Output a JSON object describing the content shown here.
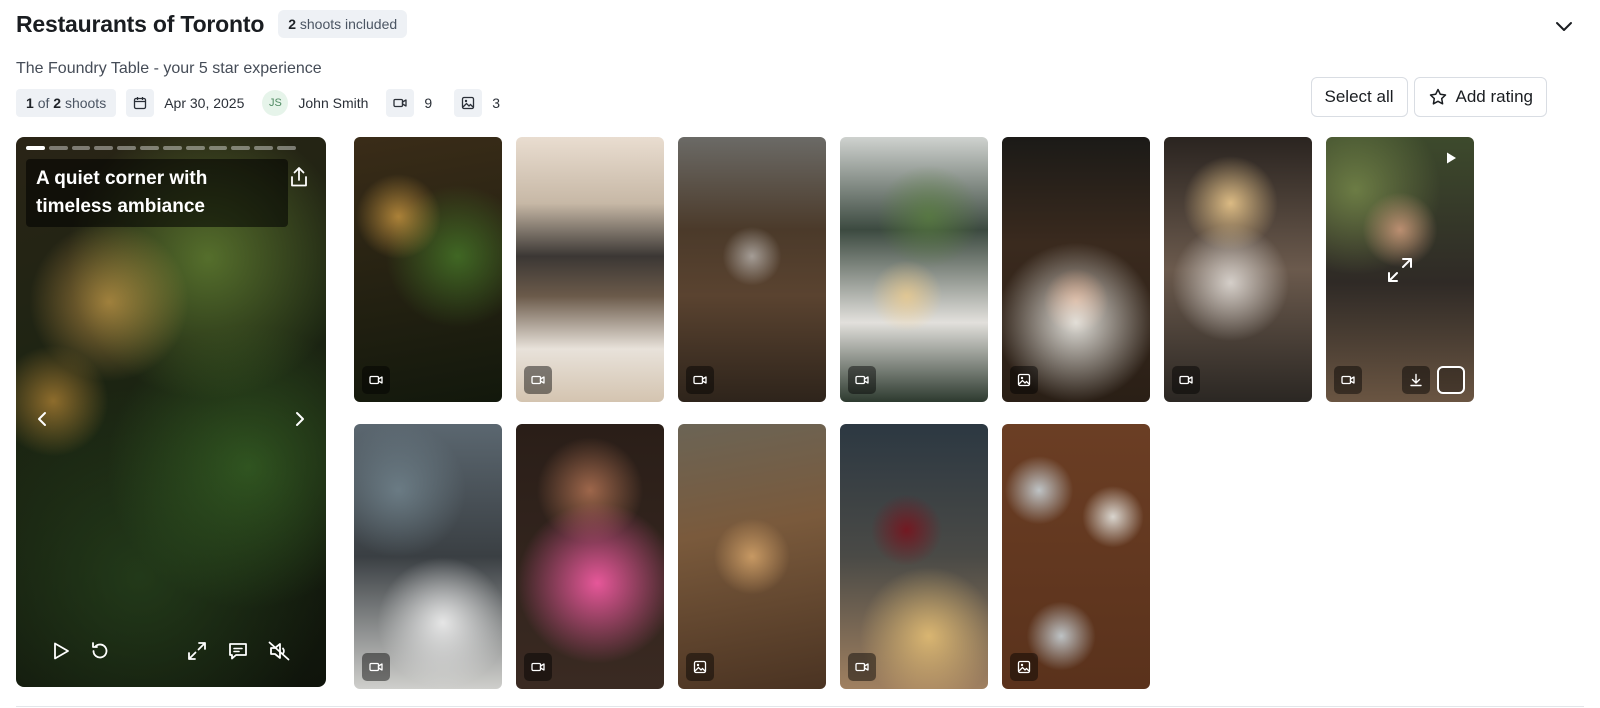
{
  "header": {
    "title": "Restaurants of Toronto",
    "badge_count": "2",
    "badge_text": "shoots included"
  },
  "subtitle": "The Foundry Table - your 5 star experience",
  "meta": {
    "shoot_current": "1",
    "shoot_of": "of",
    "shoot_total": "2",
    "shoot_label": "shoots",
    "date": "Apr 30, 2025",
    "user_initials": "JS",
    "user_name": "John Smith",
    "video_count": "9",
    "photo_count": "3"
  },
  "actions": {
    "select_all": "Select all",
    "add_rating": "Add rating"
  },
  "player": {
    "caption": "A quiet corner with timeless ambiance",
    "progress_segments": 12,
    "active_segment": 1
  },
  "thumbnails": [
    {
      "type": "video"
    },
    {
      "type": "video"
    },
    {
      "type": "video"
    },
    {
      "type": "video"
    },
    {
      "type": "photo"
    },
    {
      "type": "video"
    },
    {
      "type": "video",
      "hovered": true
    },
    {
      "type": "video"
    },
    {
      "type": "video"
    },
    {
      "type": "photo"
    },
    {
      "type": "video"
    },
    {
      "type": "photo"
    }
  ],
  "icons": {
    "collapse": "chevron-down-icon",
    "calendar": "calendar-icon",
    "video": "video-icon",
    "photo": "photo-icon",
    "star": "star-icon",
    "share": "share-icon",
    "play": "play-icon",
    "replay": "replay-icon",
    "fullscreen": "fullscreen-icon",
    "comment": "comment-icon",
    "mute": "mute-icon"
  }
}
